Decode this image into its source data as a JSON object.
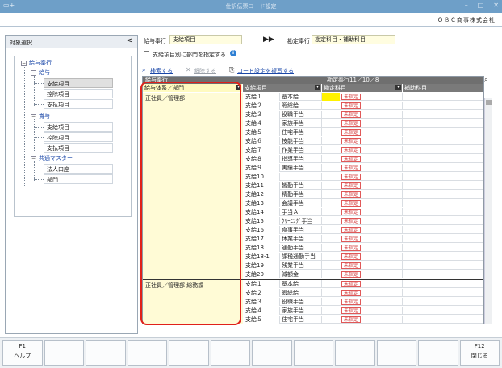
{
  "window": {
    "title": "仕訳伝票コード設定",
    "company": "ＯＢＣ商事株式会社"
  },
  "left_panel": {
    "title": "対象選択",
    "collapse_glyph": "<",
    "tree": {
      "root": "給与奉行",
      "groups": [
        {
          "label": "給与",
          "items": [
            "支給項目",
            "控除項目",
            "支払項目"
          ]
        },
        {
          "label": "賞与",
          "items": [
            "支給項目",
            "控除項目",
            "支払項目"
          ]
        },
        {
          "label": "共通マスター",
          "items": [
            "法人口座",
            "部門"
          ]
        }
      ]
    }
  },
  "right_panel": {
    "payroll_label": "給与奉行",
    "payroll_value": "支給項目",
    "arrow": "▶▶",
    "accounting_label": "勘定奉行",
    "accounting_value": "勘定科目・補助科目",
    "checkbox_label": "支給項目別に部門を指定する",
    "actions": {
      "search": "検索する",
      "clear": "解除する",
      "copy": "コード設定を複写する"
    }
  },
  "grid": {
    "group_header_left": "給与奉行",
    "group_header_right": "勘定奉行11／10／8",
    "columns": [
      "給与体系／部門",
      "支給項目",
      "勘定科目",
      "補助科目"
    ],
    "unspecified": "未指定",
    "sections": [
      {
        "dept": "正社員／管理部",
        "rows": [
          [
            "支給１",
            "基本給"
          ],
          [
            "支給２",
            "暇総給"
          ],
          [
            "支給３",
            "役職手当"
          ],
          [
            "支給４",
            "家族手当"
          ],
          [
            "支給５",
            "住宅手当"
          ],
          [
            "支給６",
            "技能手当"
          ],
          [
            "支給７",
            "作業手当"
          ],
          [
            "支給８",
            "指導手当"
          ],
          [
            "支給９",
            "実績手当"
          ],
          [
            "支給10",
            ""
          ],
          [
            "支給11",
            "皆勤手当"
          ],
          [
            "支給12",
            "精勤手当"
          ],
          [
            "支給13",
            "会議手当"
          ],
          [
            "支給14",
            "手当Ａ"
          ],
          [
            "支給15",
            "ｸﾘｰﾆﾝｸﾞ手当"
          ],
          [
            "支給16",
            "食事手当"
          ],
          [
            "支給17",
            "休業手当"
          ],
          [
            "支給18",
            "通勤手当"
          ],
          [
            "支給18-1",
            "課税通勤手当"
          ],
          [
            "支給19",
            "残業手当"
          ],
          [
            "支給20",
            "減額金"
          ]
        ]
      },
      {
        "dept": "正社員／管理部 総務課",
        "rows": [
          [
            "支給１",
            "基本給"
          ],
          [
            "支給２",
            "暇総給"
          ],
          [
            "支給３",
            "役職手当"
          ],
          [
            "支給４",
            "家族手当"
          ],
          [
            "支給５",
            "住宅手当"
          ]
        ]
      }
    ]
  },
  "fkeys": [
    {
      "n": "F1",
      "l": "ヘルプ"
    },
    {
      "n": "",
      "l": ""
    },
    {
      "n": "",
      "l": ""
    },
    {
      "n": "",
      "l": ""
    },
    {
      "n": "",
      "l": ""
    },
    {
      "n": "",
      "l": ""
    },
    {
      "n": "",
      "l": ""
    },
    {
      "n": "",
      "l": ""
    },
    {
      "n": "",
      "l": ""
    },
    {
      "n": "",
      "l": ""
    },
    {
      "n": "",
      "l": ""
    },
    {
      "n": "F12",
      "l": "閉じる"
    }
  ],
  "colors": {
    "titlebar": "#6e9fc8",
    "input_bg": "#fffde0",
    "highlight": "#fff200",
    "red_box": "#e0201a",
    "badge": "#d43d3d",
    "link": "#1a47a8"
  }
}
